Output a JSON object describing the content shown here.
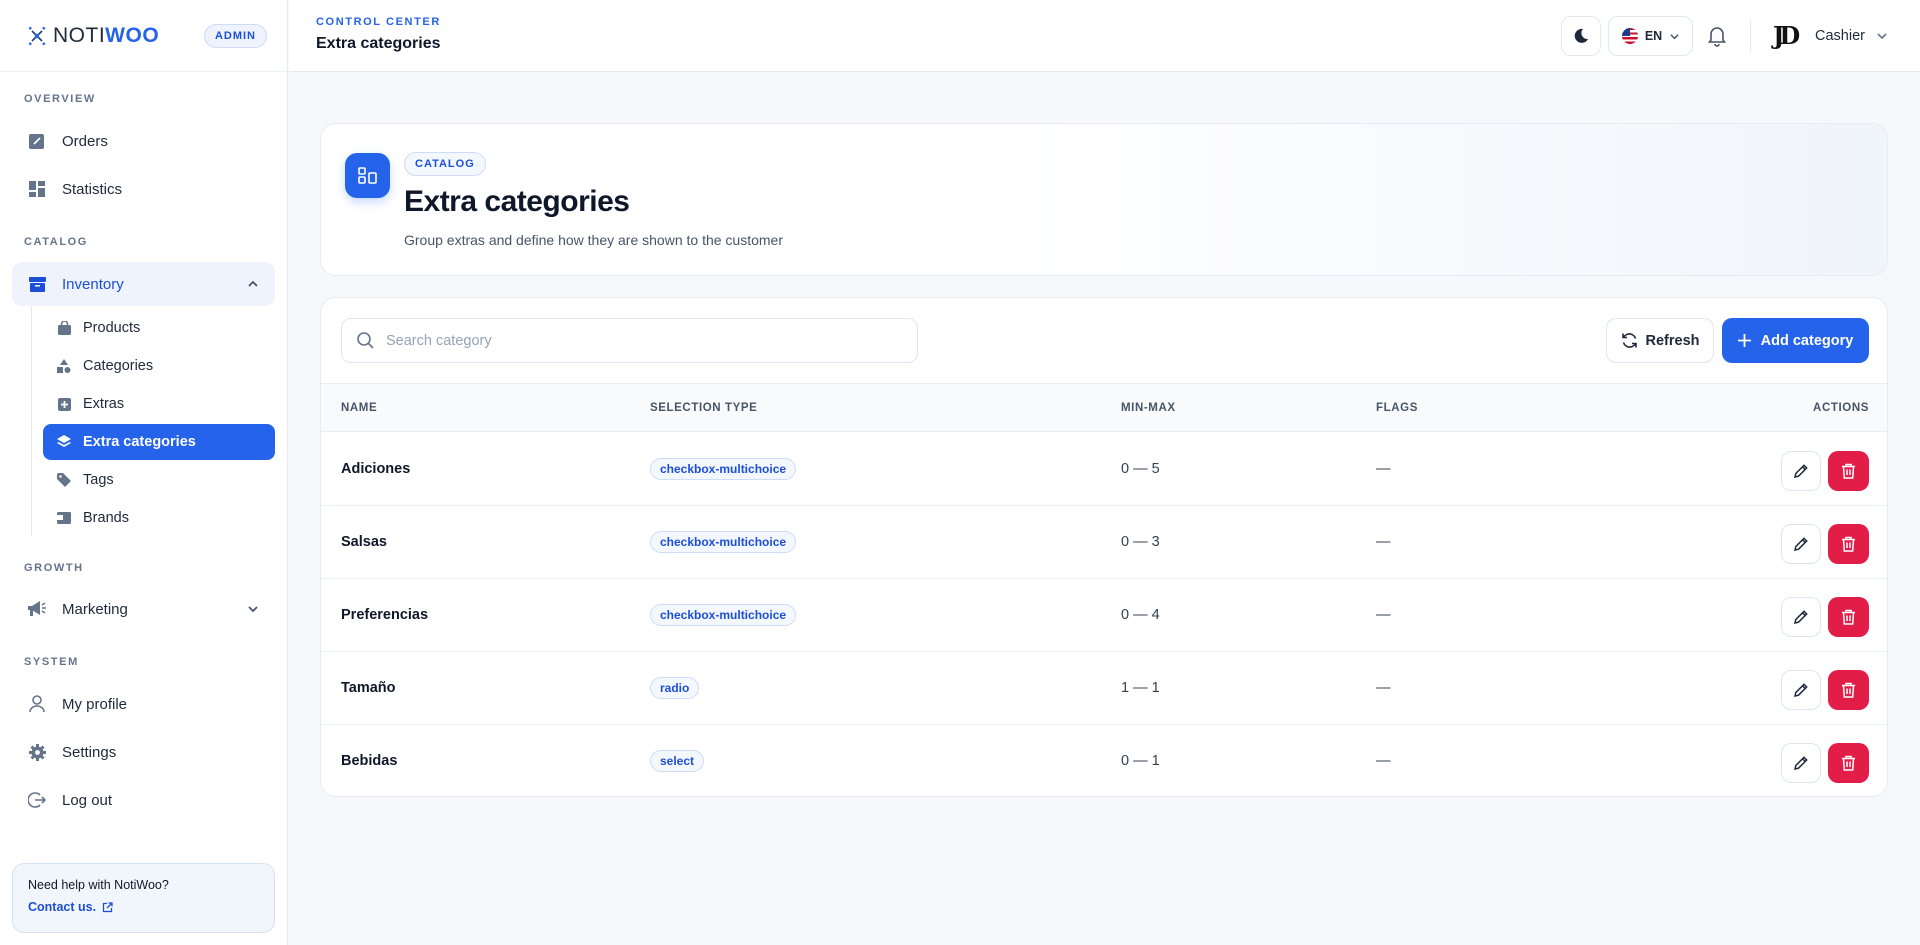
{
  "brand": {
    "name_part1": "NOTI",
    "name_part2": "WOO",
    "role_badge": "ADMIN"
  },
  "sidebar": {
    "sections": {
      "overview": "OVERVIEW",
      "catalog": "CATALOG",
      "growth": "GROWTH",
      "system": "SYSTEM"
    },
    "overview_items": [
      {
        "label": "Orders",
        "icon": "edit-square-icon"
      },
      {
        "label": "Statistics",
        "icon": "dashboard-icon"
      }
    ],
    "inventory": {
      "label": "Inventory",
      "icon": "archive-icon",
      "expanded": true
    },
    "inventory_items": [
      {
        "label": "Products",
        "icon": "bag-icon"
      },
      {
        "label": "Categories",
        "icon": "shapes-icon"
      },
      {
        "label": "Extras",
        "icon": "plus-square-icon"
      },
      {
        "label": "Extra categories",
        "icon": "layers-icon",
        "active": true
      },
      {
        "label": "Tags",
        "icon": "tag-icon"
      },
      {
        "label": "Brands",
        "icon": "wallet-icon"
      }
    ],
    "marketing": {
      "label": "Marketing",
      "icon": "megaphone-icon"
    },
    "system_items": [
      {
        "label": "My profile",
        "icon": "user-icon"
      },
      {
        "label": "Settings",
        "icon": "gear-icon"
      },
      {
        "label": "Log out",
        "icon": "logout-icon"
      }
    ],
    "help": {
      "title": "Need help with NotiWoo?",
      "link": "Contact us."
    }
  },
  "header": {
    "breadcrumb": "CONTROL CENTER",
    "title": "Extra categories",
    "language": "EN",
    "user_initials": "JD",
    "user_name": "Cashier"
  },
  "hero": {
    "badge": "CATALOG",
    "title": "Extra categories",
    "subtitle": "Group extras and define how they are shown to the customer"
  },
  "toolbar": {
    "search_placeholder": "Search category",
    "refresh_label": "Refresh",
    "add_label": "Add category"
  },
  "table": {
    "columns": {
      "name": "NAME",
      "selection_type": "SELECTION TYPE",
      "min_max": "MIN-MAX",
      "flags": "FLAGS",
      "actions": "ACTIONS"
    },
    "rows": [
      {
        "name": "Adiciones",
        "selection_type": "checkbox-multichoice",
        "min_max": "0 — 5",
        "flags": "—"
      },
      {
        "name": "Salsas",
        "selection_type": "checkbox-multichoice",
        "min_max": "0 — 3",
        "flags": "—"
      },
      {
        "name": "Preferencias",
        "selection_type": "checkbox-multichoice",
        "min_max": "0 — 4",
        "flags": "—"
      },
      {
        "name": "Tamaño",
        "selection_type": "radio",
        "min_max": "1 — 1",
        "flags": "—"
      },
      {
        "name": "Bebidas",
        "selection_type": "select",
        "min_max": "0 — 1",
        "flags": "—"
      }
    ]
  },
  "colors": {
    "accent": "#2563eb",
    "danger": "#e11d48",
    "sidebar_active_bg": "#eef3fd"
  }
}
